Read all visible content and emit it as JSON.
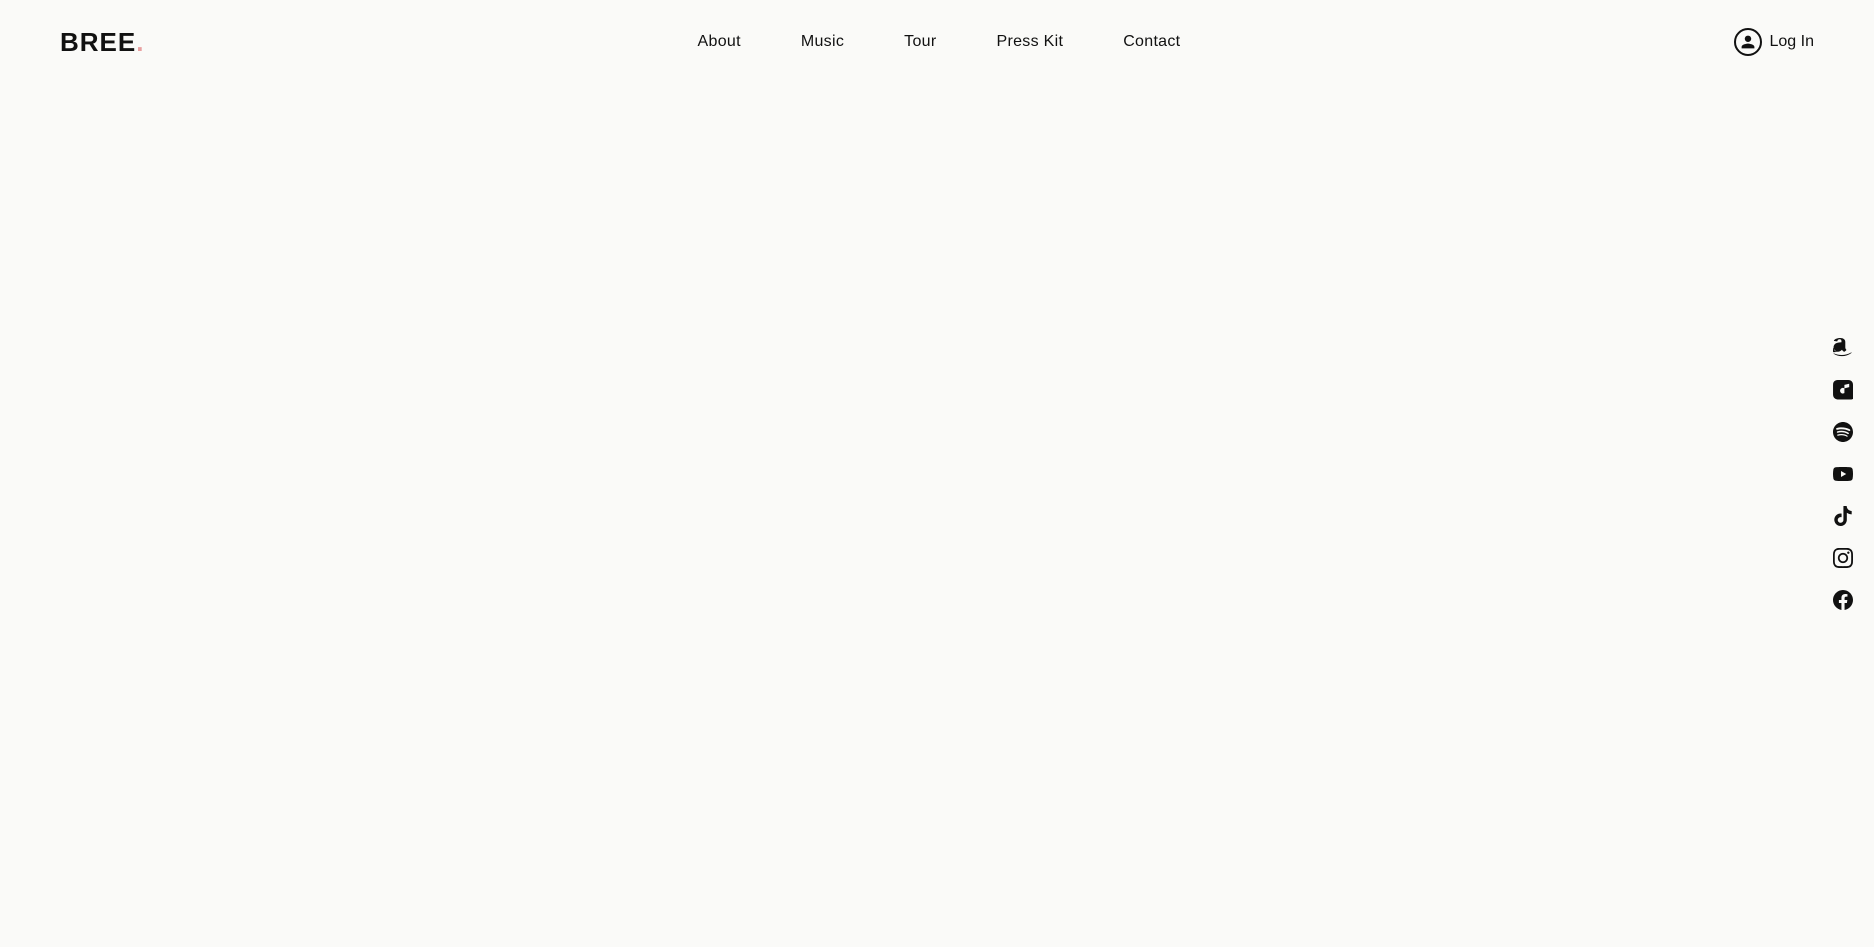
{
  "header": {
    "logo_text": "BREE",
    "logo_dot": ".",
    "nav_items": [
      {
        "label": "About",
        "href": "#about"
      },
      {
        "label": "Music",
        "href": "#music"
      },
      {
        "label": "Tour",
        "href": "#tour"
      },
      {
        "label": "Press Kit",
        "href": "#press-kit"
      },
      {
        "label": "Contact",
        "href": "#contact"
      }
    ],
    "login_label": "Log In"
  },
  "social_links": [
    {
      "name": "amazon-music-icon",
      "label": "Amazon Music"
    },
    {
      "name": "apple-music-icon",
      "label": "Apple Music"
    },
    {
      "name": "spotify-icon",
      "label": "Spotify"
    },
    {
      "name": "youtube-icon",
      "label": "YouTube"
    },
    {
      "name": "tiktok-icon",
      "label": "TikTok"
    },
    {
      "name": "instagram-icon",
      "label": "Instagram"
    },
    {
      "name": "facebook-icon",
      "label": "Facebook"
    }
  ]
}
